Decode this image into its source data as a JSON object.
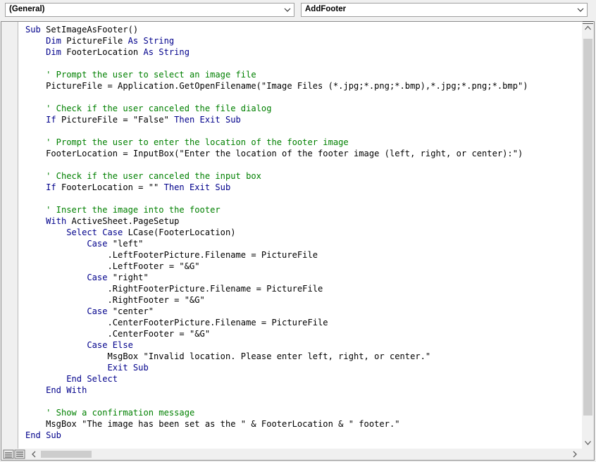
{
  "object_combo": {
    "value": "(General)"
  },
  "procedure_combo": {
    "value": "AddFooter"
  },
  "code_lines": [
    [
      {
        "k": "kw",
        "t": "Sub"
      },
      {
        "t": " SetImageAsFooter()"
      }
    ],
    [
      {
        "t": "    "
      },
      {
        "k": "kw",
        "t": "Dim"
      },
      {
        "t": " PictureFile "
      },
      {
        "k": "kw",
        "t": "As String"
      }
    ],
    [
      {
        "t": "    "
      },
      {
        "k": "kw",
        "t": "Dim"
      },
      {
        "t": " FooterLocation "
      },
      {
        "k": "kw",
        "t": "As String"
      }
    ],
    [],
    [
      {
        "t": "    "
      },
      {
        "k": "cm",
        "t": "' Prompt the user to select an image file"
      }
    ],
    [
      {
        "t": "    PictureFile = Application.GetOpenFilename(\"Image Files (*.jpg;*.png;*.bmp),*.jpg;*.png;*.bmp\")"
      }
    ],
    [],
    [
      {
        "t": "    "
      },
      {
        "k": "cm",
        "t": "' Check if the user canceled the file dialog"
      }
    ],
    [
      {
        "t": "    "
      },
      {
        "k": "kw",
        "t": "If"
      },
      {
        "t": " PictureFile = \"False\" "
      },
      {
        "k": "kw",
        "t": "Then Exit Sub"
      }
    ],
    [],
    [
      {
        "t": "    "
      },
      {
        "k": "cm",
        "t": "' Prompt the user to enter the location of the footer image"
      }
    ],
    [
      {
        "t": "    FooterLocation = InputBox(\"Enter the location of the footer image (left, right, or center):\")"
      }
    ],
    [],
    [
      {
        "t": "    "
      },
      {
        "k": "cm",
        "t": "' Check if the user canceled the input box"
      }
    ],
    [
      {
        "t": "    "
      },
      {
        "k": "kw",
        "t": "If"
      },
      {
        "t": " FooterLocation = \"\" "
      },
      {
        "k": "kw",
        "t": "Then Exit Sub"
      }
    ],
    [],
    [
      {
        "t": "    "
      },
      {
        "k": "cm",
        "t": "' Insert the image into the footer"
      }
    ],
    [
      {
        "t": "    "
      },
      {
        "k": "kw",
        "t": "With"
      },
      {
        "t": " ActiveSheet.PageSetup"
      }
    ],
    [
      {
        "t": "        "
      },
      {
        "k": "kw",
        "t": "Select Case"
      },
      {
        "t": " LCase(FooterLocation)"
      }
    ],
    [
      {
        "t": "            "
      },
      {
        "k": "kw",
        "t": "Case"
      },
      {
        "t": " \"left\""
      }
    ],
    [
      {
        "t": "                .LeftFooterPicture.Filename = PictureFile"
      }
    ],
    [
      {
        "t": "                .LeftFooter = \"&G\""
      }
    ],
    [
      {
        "t": "            "
      },
      {
        "k": "kw",
        "t": "Case"
      },
      {
        "t": " \"right\""
      }
    ],
    [
      {
        "t": "                .RightFooterPicture.Filename = PictureFile"
      }
    ],
    [
      {
        "t": "                .RightFooter = \"&G\""
      }
    ],
    [
      {
        "t": "            "
      },
      {
        "k": "kw",
        "t": "Case"
      },
      {
        "t": " \"center\""
      }
    ],
    [
      {
        "t": "                .CenterFooterPicture.Filename = PictureFile"
      }
    ],
    [
      {
        "t": "                .CenterFooter = \"&G\""
      }
    ],
    [
      {
        "t": "            "
      },
      {
        "k": "kw",
        "t": "Case Else"
      }
    ],
    [
      {
        "t": "                MsgBox \"Invalid location. Please enter left, right, or center.\""
      }
    ],
    [
      {
        "t": "                "
      },
      {
        "k": "kw",
        "t": "Exit Sub"
      }
    ],
    [
      {
        "t": "        "
      },
      {
        "k": "kw",
        "t": "End Select"
      }
    ],
    [
      {
        "t": "    "
      },
      {
        "k": "kw",
        "t": "End With"
      }
    ],
    [],
    [
      {
        "t": "    "
      },
      {
        "k": "cm",
        "t": "' Show a confirmation message"
      }
    ],
    [
      {
        "t": "    MsgBox \"The image has been set as the \" & FooterLocation & \" footer.\""
      }
    ],
    [
      {
        "k": "kw",
        "t": "End Sub"
      }
    ]
  ],
  "colors": {
    "keyword": "#00008b",
    "comment": "#008000",
    "text": "#000000"
  },
  "icons": {
    "dropdown": "chevron-down-icon",
    "scroll_up": "arrow-up-icon",
    "scroll_down": "arrow-down-icon",
    "scroll_left": "arrow-left-icon",
    "scroll_right": "arrow-right-icon",
    "view_buttons": "procedure-view-icon"
  }
}
